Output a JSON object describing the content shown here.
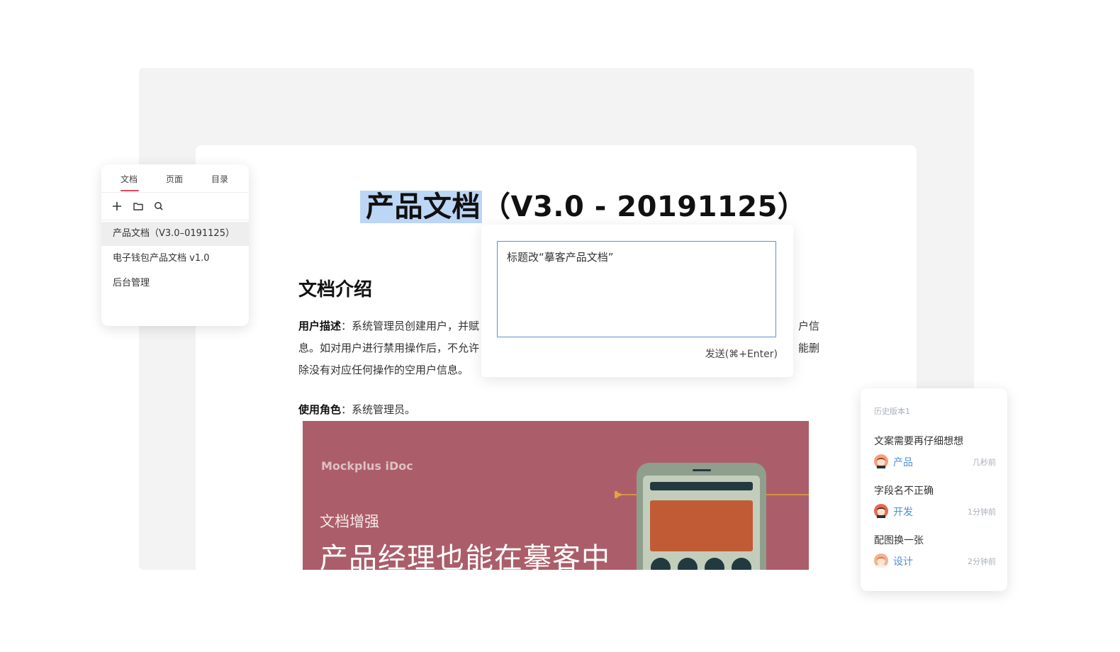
{
  "document": {
    "title_highlight": "产品文档",
    "title_rest": "（V3.0 - 20191125）",
    "section_heading": "文档介绍",
    "desc_label": "用户描述",
    "desc_line1": "：系统管理员创建用户，并赋",
    "desc_line1_tail": "户信",
    "desc_line2": "息。如对用户进行禁用操作后，不允许",
    "desc_line2_tail": "能删",
    "desc_line3": "除没有对应任何操作的空用户信息。",
    "role_label": "使用角色",
    "role_value": "：系统管理员。",
    "banner": {
      "brand": "Mockplus iDoc",
      "subtitle": "文档增强",
      "headline": "产品经理也能在摹客中",
      "color": "#ab5e69"
    }
  },
  "sidebar": {
    "tabs": [
      {
        "label": "文档",
        "active": true
      },
      {
        "label": "页面",
        "active": false
      },
      {
        "label": "目录",
        "active": false
      }
    ],
    "tools": [
      "plus-icon",
      "folder-icon",
      "search-icon"
    ],
    "items": [
      {
        "label": "产品文档（V3.0–0191125）",
        "selected": true
      },
      {
        "label": "电子钱包产品文档 v1.0",
        "selected": false
      },
      {
        "label": "后台管理",
        "selected": false
      }
    ],
    "accent": "#e0475e"
  },
  "comment_popup": {
    "text": "标题改“摹客产品文档”",
    "send_label": "发送(⌘+Enter)",
    "border_color": "#5b8fd8"
  },
  "history": {
    "title": "历史版本1",
    "entries": [
      {
        "text": "文案需要再仔细想想",
        "user": "产品",
        "time": "几秒前"
      },
      {
        "text": "字段名不正确",
        "user": "开发",
        "time": "1分钟前"
      },
      {
        "text": "配图换一张",
        "user": "设计",
        "time": "2分钟前"
      }
    ],
    "user_color": "#4a90d9"
  }
}
